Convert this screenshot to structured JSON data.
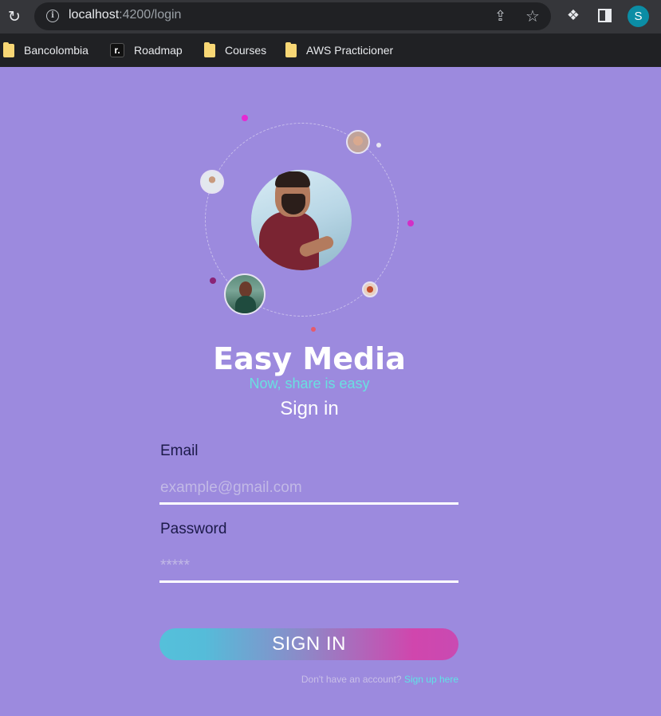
{
  "browser": {
    "url_host": "localhost",
    "url_path": ":4200/login",
    "profile_initial": "S",
    "bookmarks": [
      {
        "label": "Bancolombia",
        "icon": "folder-icon"
      },
      {
        "label": "Roadmap",
        "icon": "roadmap-icon"
      },
      {
        "label": "Courses",
        "icon": "folder-icon"
      },
      {
        "label": "AWS Practicioner",
        "icon": "folder-icon"
      }
    ]
  },
  "brand": {
    "title": "Easy Media",
    "tagline": "Now, share is easy"
  },
  "form": {
    "title": "Sign in",
    "email_label": "Email",
    "email_placeholder": "example@gmail.com",
    "password_label": "Password",
    "password_placeholder": "*****",
    "submit_label": "SIGN IN",
    "signup_prompt": "Don't have an account?",
    "signup_link": "Sign up here"
  },
  "colors": {
    "background": "#9c8ade",
    "tagline": "#69e0e0",
    "button_gradient_start": "#55c0da",
    "button_gradient_end": "#c94ab2"
  }
}
